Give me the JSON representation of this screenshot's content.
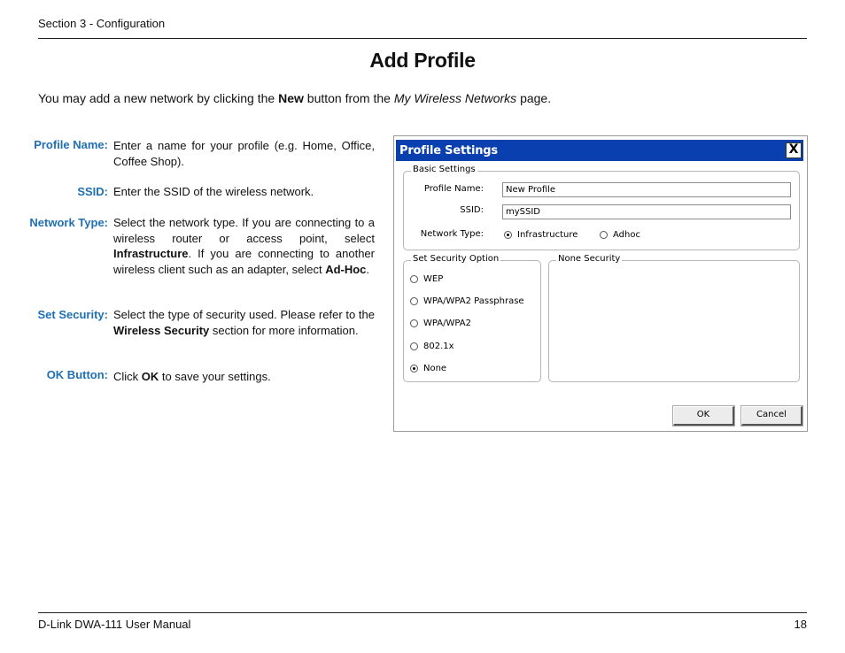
{
  "header": {
    "section": "Section 3 - Configuration"
  },
  "title": "Add Profile",
  "intro": {
    "part1": "You may add a new network by clicking the ",
    "bold": "New",
    "part2": " button from the ",
    "italic": "My Wireless Networks",
    "part3": " page."
  },
  "items": [
    {
      "label": "Profile Name:",
      "text": "Enter a name for your profile (e.g. Home, Office, Coffee Shop)."
    },
    {
      "label": "SSID:",
      "text": "Enter the SSID of the wireless network."
    },
    {
      "label": "Network Type:",
      "text1": "Select the network type. If you are connecting to a wireless router or access point, select ",
      "bold1": "Infrastructure",
      "text2": ". If you are connecting to another wireless client such as an adapter, select ",
      "bold2": "Ad-Hoc",
      "text3": "."
    },
    {
      "label": "Set Security:",
      "text1": "Select the type of security used. Please refer to the ",
      "bold1": "Wireless Security",
      "text2": " section for more information."
    },
    {
      "label": "OK Button:",
      "text1": "Click ",
      "bold1": "OK",
      "text2": " to save your settings."
    }
  ],
  "dialog": {
    "title": "Profile Settings",
    "close": "X",
    "basic_settings": {
      "legend": "Basic Settings",
      "profile_name_label": "Profile Name:",
      "profile_name_value": "New Profile",
      "ssid_label": "SSID:",
      "ssid_value": "mySSID",
      "network_type_label": "Network Type:",
      "infrastructure": "Infrastructure",
      "adhoc": "Adhoc"
    },
    "security_option": {
      "legend": "Set Security Option",
      "options": [
        "WEP",
        "WPA/WPA2 Passphrase",
        "WPA/WPA2",
        "802.1x",
        "None"
      ],
      "selected": "None"
    },
    "none_security": {
      "legend": "None Security"
    },
    "ok": "OK",
    "cancel": "Cancel"
  },
  "footer": {
    "manual": "D-Link DWA-111 User Manual",
    "page": "18"
  }
}
